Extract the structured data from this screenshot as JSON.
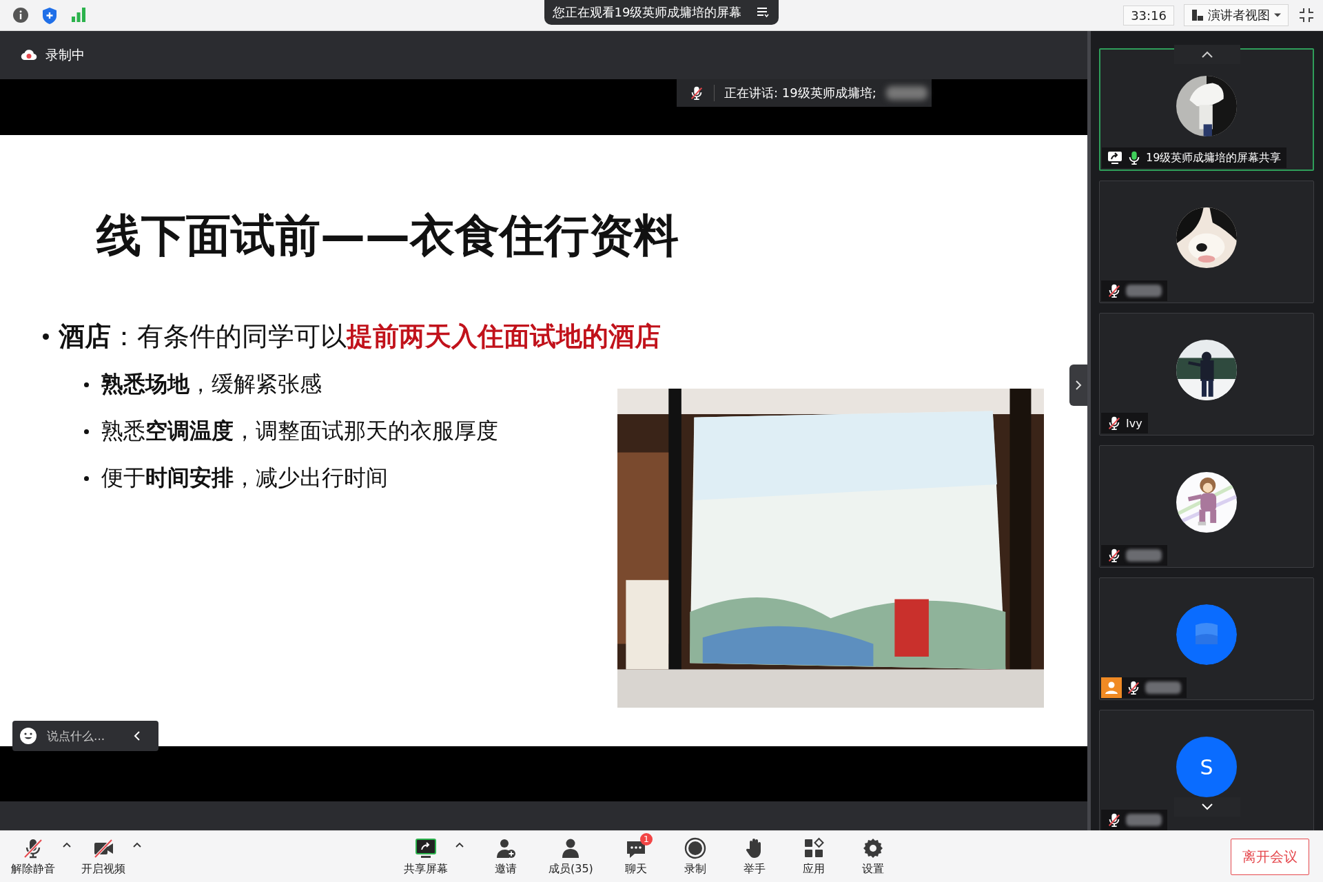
{
  "top_bar": {
    "viewing_banner": "您正在观看19级英师成墉培的屏幕",
    "timer": "33:16",
    "view_mode": "演讲者视图"
  },
  "recording": {
    "label": "录制中"
  },
  "speaker_indicator": {
    "label": "正在讲话: 19级英师成墉培;"
  },
  "slide": {
    "title": "线下面试前——衣食住行资料",
    "bullet": {
      "segments": [
        {
          "text": "酒店",
          "kind": "bold"
        },
        {
          "text": "：有条件的同学可以",
          "kind": "plain"
        },
        {
          "text": "提前两天入住面试地的酒店",
          "kind": "highlight"
        }
      ]
    },
    "sub_bullets": [
      {
        "segments": [
          {
            "text": "熟悉场地",
            "kind": "bold"
          },
          {
            "text": "，缓解紧张感",
            "kind": "plain"
          }
        ]
      },
      {
        "segments": [
          {
            "text": "熟悉",
            "kind": "plain"
          },
          {
            "text": "空调温度",
            "kind": "bold"
          },
          {
            "text": "，调整面试那天的衣服厚度",
            "kind": "plain"
          }
        ]
      },
      {
        "segments": [
          {
            "text": "便于",
            "kind": "plain"
          },
          {
            "text": "时间安排",
            "kind": "bold"
          },
          {
            "text": "，减少出行时间",
            "kind": "plain"
          }
        ]
      }
    ],
    "image": {
      "kind": "picture"
    }
  },
  "chat_input": {
    "placeholder": "说点什么..."
  },
  "participants": [
    {
      "name": "19级英师成墉培的屏幕共享",
      "muted": false,
      "sharing": true,
      "selected": true,
      "kind": "picture",
      "name_hidden": false,
      "host": false
    },
    {
      "muted": true,
      "sharing": false,
      "selected": false,
      "kind": "picture",
      "name_hidden": true,
      "host": false
    },
    {
      "name": "Ivy",
      "muted": true,
      "sharing": false,
      "selected": false,
      "kind": "picture",
      "name_hidden": false,
      "host": false
    },
    {
      "muted": true,
      "sharing": false,
      "selected": false,
      "kind": "picture",
      "name_hidden": true,
      "host": false
    },
    {
      "muted": true,
      "sharing": false,
      "selected": false,
      "kind": "icon",
      "name_hidden": true,
      "host": true
    },
    {
      "muted": true,
      "sharing": false,
      "selected": false,
      "kind": "letter",
      "initial": "S",
      "name_hidden": true,
      "host": false
    }
  ],
  "toolbar": {
    "left_buttons": [
      {
        "label": "解除静音",
        "kind": "mic",
        "slashed": true,
        "menu": true
      },
      {
        "label": "开启视频",
        "kind": "camera",
        "slashed": true,
        "menu": true
      }
    ],
    "center_buttons": [
      {
        "label": "共享屏幕",
        "kind": "share",
        "slashed": false,
        "menu": true
      },
      {
        "label": "邀请",
        "kind": "invite",
        "slashed": false,
        "menu": false
      },
      {
        "label": "成员(35)",
        "kind": "members",
        "slashed": false,
        "menu": false
      },
      {
        "label": "聊天",
        "kind": "chat",
        "slashed": false,
        "menu": false,
        "badge": "1"
      },
      {
        "label": "录制",
        "kind": "record",
        "slashed": false,
        "menu": false
      },
      {
        "label": "举手",
        "kind": "hand",
        "slashed": false,
        "menu": false
      },
      {
        "label": "应用",
        "kind": "apps",
        "slashed": false,
        "menu": false
      },
      {
        "label": "设置",
        "kind": "settings",
        "slashed": false,
        "menu": false
      }
    ],
    "leave_button": "离开会议"
  }
}
